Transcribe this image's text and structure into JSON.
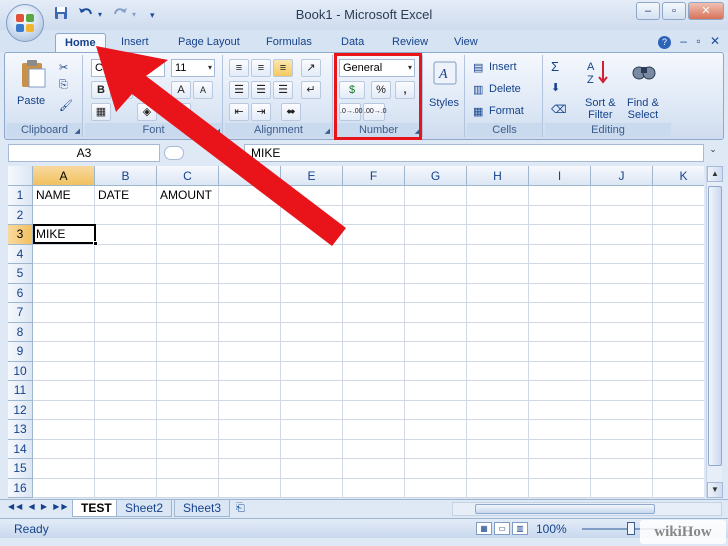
{
  "window": {
    "title": "Book1 - Microsoft Excel",
    "buttons": {
      "minimize": "–",
      "restore": "▫",
      "close": "✕"
    }
  },
  "quick_access": {
    "save_icon": "save-icon",
    "undo_icon": "undo-icon",
    "redo_icon": "redo-icon",
    "customize_icon": "customize-icon"
  },
  "tabs": [
    {
      "label": "Home",
      "active": true
    },
    {
      "label": "Insert"
    },
    {
      "label": "Page Layout"
    },
    {
      "label": "Formulas"
    },
    {
      "label": "Data"
    },
    {
      "label": "Review"
    },
    {
      "label": "View"
    }
  ],
  "ribbon": {
    "clipboard": {
      "label": "Clipboard",
      "paste": "Paste"
    },
    "font": {
      "label": "Font",
      "font_name": "Ca",
      "font_size": "11",
      "bold": "B",
      "italic": "I",
      "underline": "U",
      "grow": "A",
      "shrink": "A"
    },
    "alignment": {
      "label": "Alignment"
    },
    "number": {
      "label": "Number",
      "format": "General",
      "currency": "$",
      "percent": "%",
      "comma": ",",
      "inc_decimal": ".0→.00",
      "dec_decimal": ".00→.0"
    },
    "styles": {
      "label": "Styles"
    },
    "cells": {
      "label": "Cells",
      "insert": "Insert",
      "delete": "Delete",
      "format": "Format"
    },
    "editing": {
      "label": "Editing",
      "sort_filter": [
        "Sort &",
        "Filter"
      ],
      "find_select": [
        "Find &",
        "Select"
      ],
      "sigma": "Σ"
    }
  },
  "formula_bar": {
    "name_box": "A3",
    "fx": "fx",
    "content": "MIKE"
  },
  "columns": [
    "A",
    "B",
    "C",
    "D",
    "E",
    "F",
    "G",
    "H",
    "I",
    "J",
    "K"
  ],
  "rows": [
    "1",
    "2",
    "3",
    "4",
    "5",
    "6",
    "7",
    "8",
    "9",
    "10",
    "11",
    "12",
    "13",
    "14",
    "15",
    "16"
  ],
  "cells": {
    "A1": "NAME",
    "B1": "DATE",
    "C1": "AMOUNT",
    "A3": "MIKE"
  },
  "active_cell": "A3",
  "sheets": [
    {
      "label": "TEST",
      "active": true
    },
    {
      "label": "Sheet2"
    },
    {
      "label": "Sheet3"
    }
  ],
  "status": {
    "text": "Ready",
    "zoom": "100%"
  },
  "watermark": "wikiHow",
  "colors": {
    "annotation_red": "#e8141a",
    "ribbon_text": "#15428b",
    "selected_header": "#f1c15f"
  }
}
